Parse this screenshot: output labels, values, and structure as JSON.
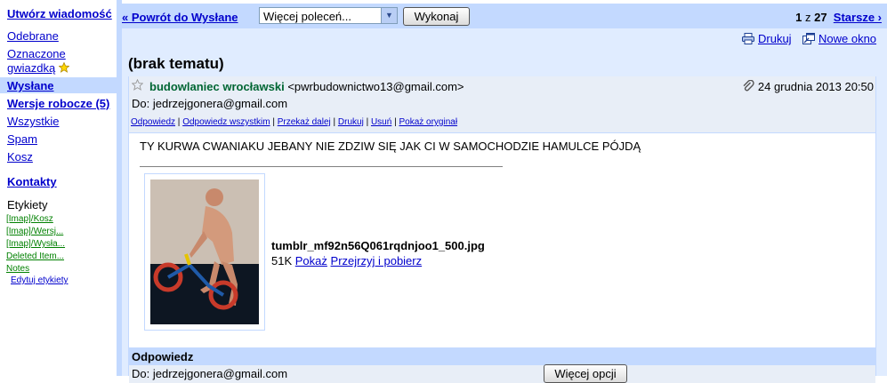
{
  "nav": {
    "compose": "Utwórz wiadomość",
    "inbox": "Odebrane",
    "starred": "Oznaczone gwiazdką",
    "sent": "Wysłane",
    "drafts": "Wersje robocze (5)",
    "all": "Wszystkie",
    "spam": "Spam",
    "trash": "Kosz",
    "contacts": "Kontakty",
    "labels_title": "Etykiety",
    "labels": [
      "[Imap]/Kosz",
      "[Imap]/Wersj...",
      "[Imap]/Wysła...",
      "Deleted Item...",
      "Notes"
    ],
    "edit_labels": "Edytuj etykiety"
  },
  "toolbar": {
    "back": "« Powrót do Wysłane",
    "more_select": "Więcej poleceń...",
    "go": "Wykonaj",
    "pager_pos": "1",
    "pager_of": " z ",
    "pager_total": "27",
    "older": "Starsze ›"
  },
  "util": {
    "print": "Drukuj",
    "new_window": "Nowe okno"
  },
  "message": {
    "subject": "(brak tematu)",
    "from_name": "budowlaniec wrocławski",
    "from_email": "<pwrbudownictwo13@gmail.com>",
    "to": "Do: jedrzejgonera@gmail.com",
    "date": "24 grudnia 2013 20:50",
    "actions": [
      "Odpowiedz",
      "Odpowiedz wszystkim",
      "Przekaż dalej",
      "Drukuj",
      "Usuń",
      "Pokaż oryginał"
    ],
    "body": "TY KURWA CWANIAKU JEBANY NIE ZDZIW SIĘ JAK CI W SAMOCHODZIE HAMULCE PÓJDĄ",
    "attachment": {
      "filename": "tumblr_mf92n56Q061rqdnjoo1_500.jpg",
      "size": "51K",
      "show": "Pokaż",
      "view_download": "Przejrzyj i pobierz"
    }
  },
  "reply": {
    "title": "Odpowiedz",
    "to": "Do: jedrzejgonera@gmail.com",
    "more_options": "Więcej opcji"
  }
}
